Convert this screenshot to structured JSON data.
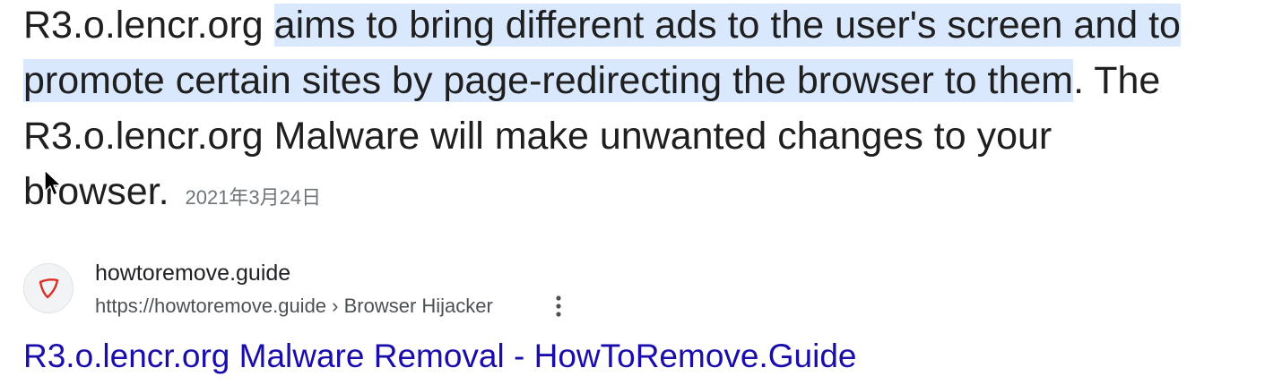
{
  "snippet": {
    "lead": "R3.o.lencr.org ",
    "highlighted": "aims to bring different ads to the user's screen and to promote certain sites by page-redirecting the browser to them",
    "after_highlight": ". The R3.o.lencr.org Malware will make unwanted changes to your browser.",
    "date": "2021年3月24日"
  },
  "result": {
    "site_name": "howtoremove.guide",
    "url": "https://howtoremove.guide › Browser Hijacker",
    "favicon": "red-shield-icon",
    "title": "R3.o.lencr.org Malware Removal - HowToRemove.Guide"
  },
  "colors": {
    "highlight": "#d3e3fd",
    "link": "#1a0dab",
    "favicon_red": "#d93025"
  }
}
